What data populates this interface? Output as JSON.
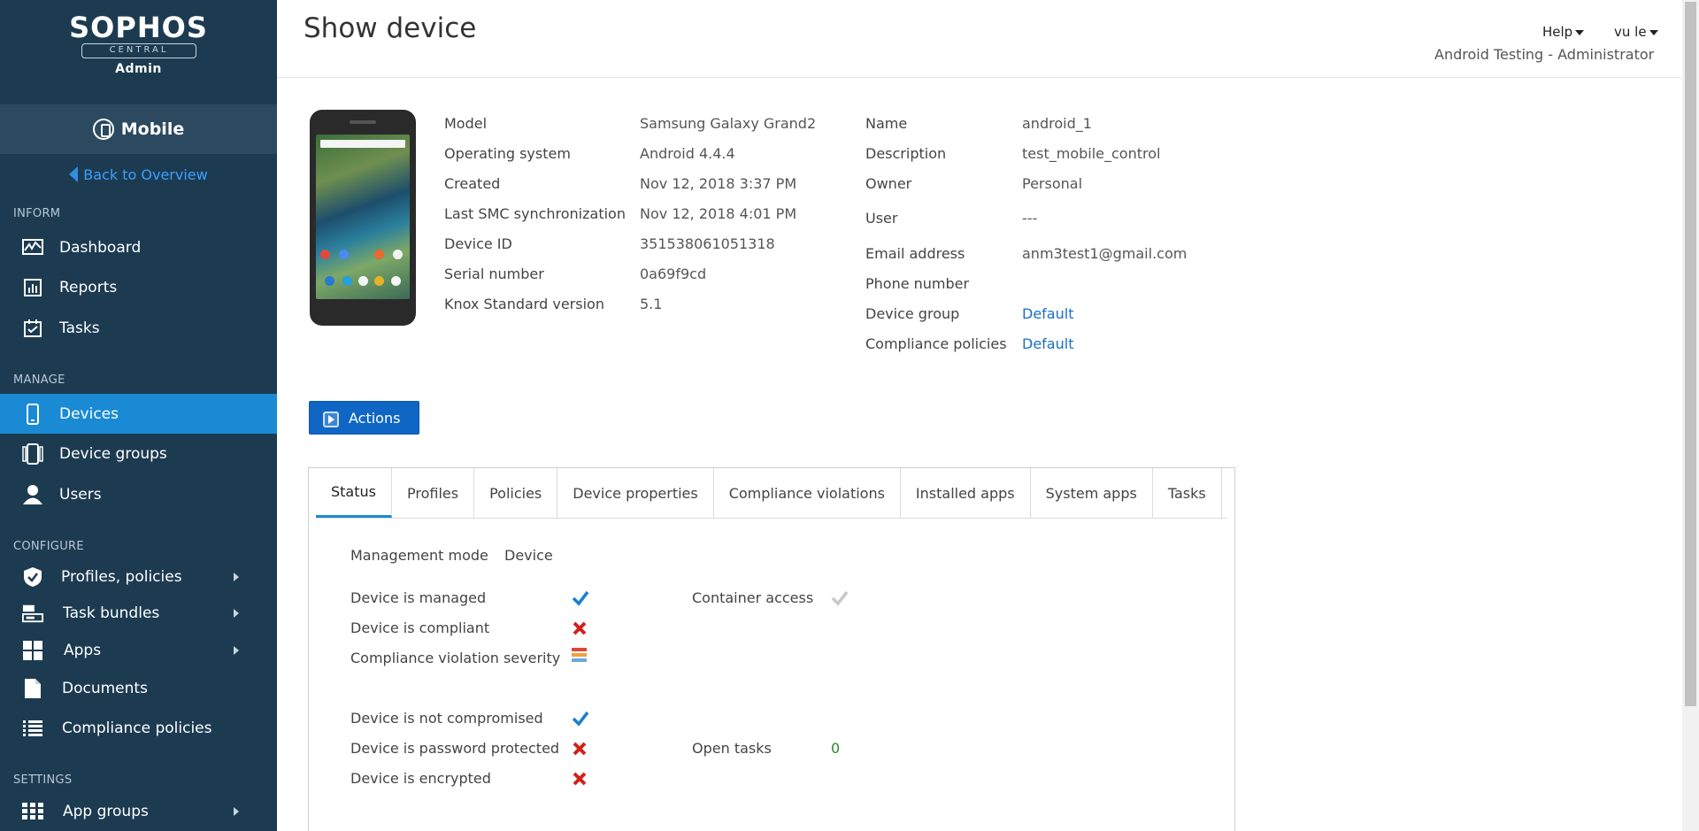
{
  "brand": {
    "name": "SOPHOS",
    "sub": "CENTRAL",
    "role": "Admin"
  },
  "module": {
    "label": "Mobile",
    "icon": "mobile-circle-icon"
  },
  "back_link": "Back to Overview",
  "sidebar": {
    "sections": [
      "INFORM",
      "MANAGE",
      "CONFIGURE",
      "SETTINGS"
    ],
    "items": [
      {
        "label": "Dashboard",
        "icon": "dashboard-icon"
      },
      {
        "label": "Reports",
        "icon": "reports-icon"
      },
      {
        "label": "Tasks",
        "icon": "tasks-icon"
      },
      {
        "label": "Devices",
        "icon": "devices-icon"
      },
      {
        "label": "Device groups",
        "icon": "device-groups-icon"
      },
      {
        "label": "Users",
        "icon": "users-icon"
      },
      {
        "label": "Profiles, policies",
        "icon": "shield-icon"
      },
      {
        "label": "Task bundles",
        "icon": "task-bundles-icon"
      },
      {
        "label": "Apps",
        "icon": "apps-icon"
      },
      {
        "label": "Documents",
        "icon": "document-icon"
      },
      {
        "label": "Compliance policies",
        "icon": "list-icon"
      },
      {
        "label": "App groups",
        "icon": "grid-icon"
      }
    ],
    "active": "Devices"
  },
  "header": {
    "title": "Show device",
    "help": "Help",
    "user": "vu le",
    "tenant": "Android Testing - Administrator"
  },
  "device": {
    "left": [
      {
        "label": "Model",
        "value": "Samsung Galaxy Grand2"
      },
      {
        "label": "Operating system",
        "value": "Android 4.4.4"
      },
      {
        "label": "Created",
        "value": "Nov 12, 2018 3:37 PM"
      },
      {
        "label": "Last SMC synchronization",
        "value": "Nov 12, 2018 4:01 PM"
      },
      {
        "label": "Device ID",
        "value": "351538061051318"
      },
      {
        "label": "Serial number",
        "value": "0a69f9cd"
      },
      {
        "label": "Knox Standard version",
        "value": "5.1"
      }
    ],
    "right": [
      {
        "label": "Name",
        "value": "android_1"
      },
      {
        "label": "Description",
        "value": "test_mobile_control"
      },
      {
        "label": "Owner",
        "value": "Personal"
      },
      {
        "label": "User",
        "value": "---"
      },
      {
        "label": "Email address",
        "value": "anm3test1@gmail.com"
      },
      {
        "label": "Phone number",
        "value": ""
      },
      {
        "label": "Device group",
        "value": "Default"
      },
      {
        "label": "Compliance policies",
        "value": "Default"
      }
    ]
  },
  "actions_label": "Actions",
  "tabs": [
    "Status",
    "Profiles",
    "Policies",
    "Device properties",
    "Compliance violations",
    "Installed apps",
    "System apps",
    "Tasks"
  ],
  "active_tab": "Status",
  "status": {
    "management_mode_label": "Management mode",
    "management_mode_value": "Device",
    "managed_label": "Device is managed",
    "compliant_label": "Device is compliant",
    "severity_label": "Compliance violation severity",
    "container_label": "Container access",
    "not_compromised_label": "Device is not compromised",
    "password_label": "Device is password protected",
    "encrypted_label": "Device is encrypted",
    "open_tasks_label": "Open tasks",
    "open_tasks_value": "0"
  },
  "colors": {
    "sidebar_bg": "#1c3b51",
    "active_item": "#1a8ad4",
    "link": "#1a6fc4",
    "check_blue": "#1a7fd0",
    "x_red": "#d0221b",
    "open_tasks_green": "#2a8a2a"
  }
}
